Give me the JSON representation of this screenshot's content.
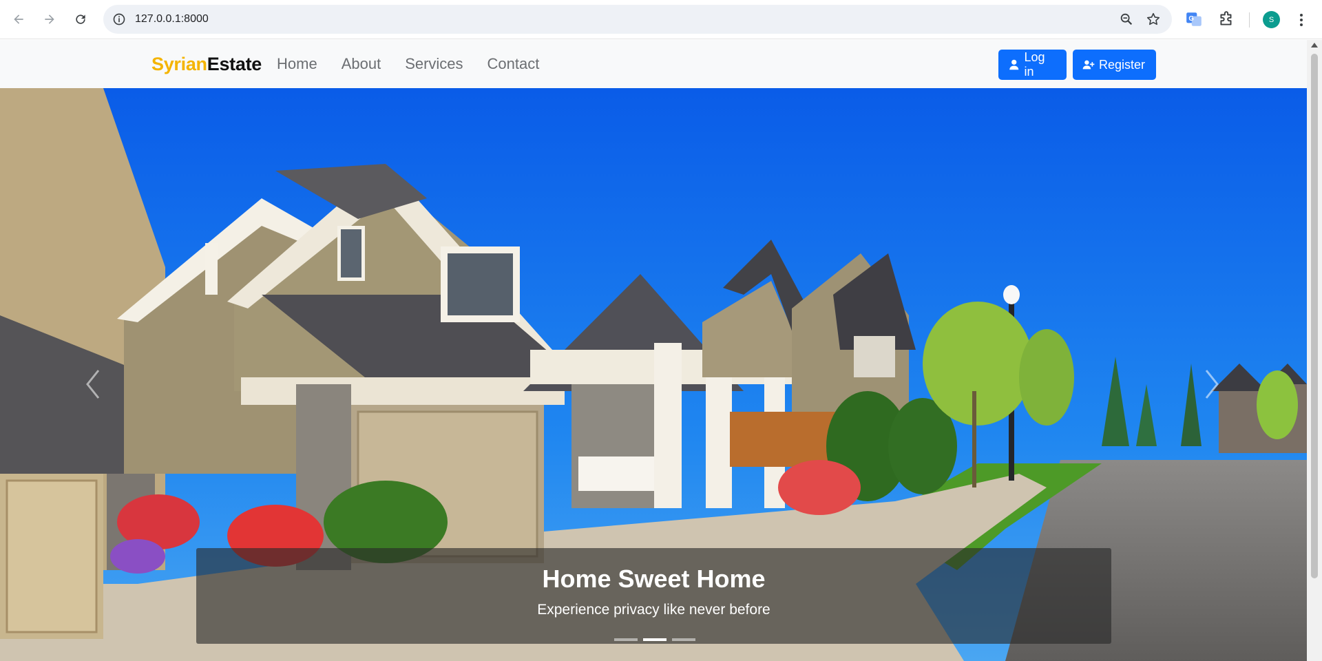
{
  "browser": {
    "url": "127.0.0.1:8000",
    "profile_initial": "S",
    "icons": [
      "back-icon",
      "forward-icon",
      "reload-icon",
      "info-icon",
      "zoom-icon",
      "star-icon",
      "translate-extension-icon",
      "extensions-puzzle-icon",
      "kebab-menu-icon"
    ]
  },
  "navbar": {
    "brand_part1": "Syrian",
    "brand_part2": "Estate",
    "links": [
      "Home",
      "About",
      "Services",
      "Contact"
    ],
    "login_label": "Log in",
    "register_label": "Register",
    "colors": {
      "brand_accent": "#f4b400",
      "button": "#0d6efd",
      "navbar_bg": "#f8f9fa"
    }
  },
  "hero": {
    "title": "Home Sweet Home",
    "subtitle": "Experience privacy like never before",
    "slide_count": 3,
    "active_slide": 2
  }
}
